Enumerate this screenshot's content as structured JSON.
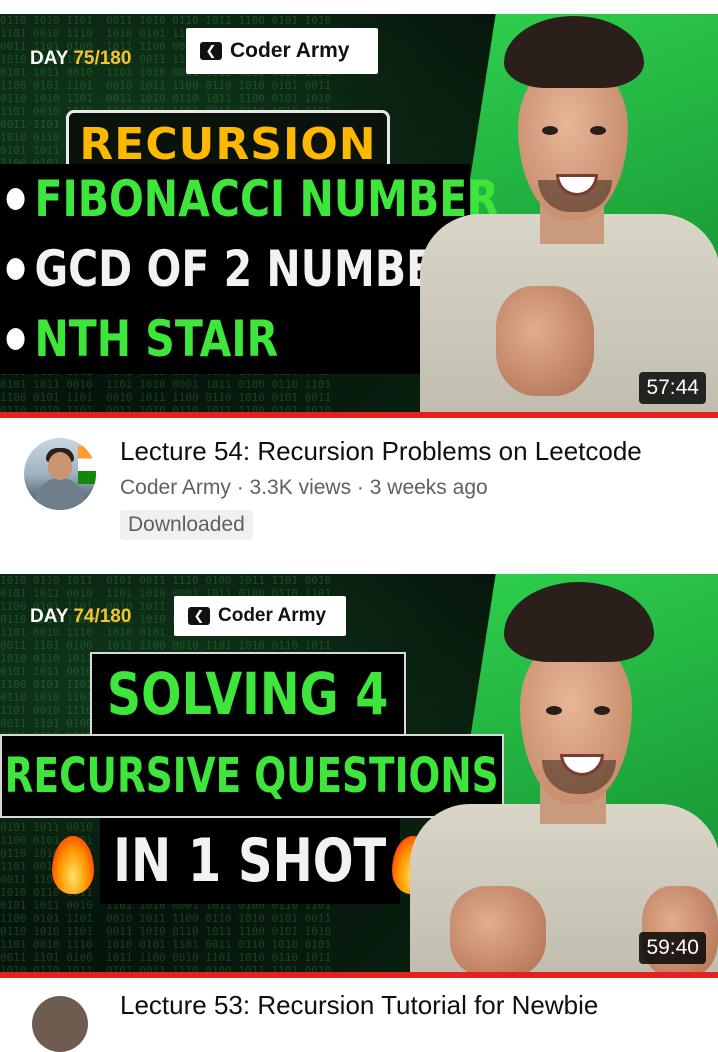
{
  "videos": [
    {
      "thumbnail": {
        "day_prefix": "DAY ",
        "day_value": "75/180",
        "brand": "Coder Army",
        "banner": "RECURSION",
        "bullets": [
          "FIBONACCI NUMBER",
          "GCD OF 2 NUMBER",
          "NTH STAIR"
        ]
      },
      "duration": "57:44",
      "title": "Lecture 54: Recursion Problems on Leetcode",
      "channel": "Coder Army",
      "separator": " · ",
      "views": "3.3K views",
      "age": "3 weeks ago",
      "badge": "Downloaded"
    },
    {
      "thumbnail": {
        "day_prefix": "DAY ",
        "day_value": "74/180",
        "brand": "Coder Army",
        "headline_1": "SOLVING 4",
        "headline_2": "RECURSIVE QUESTIONS",
        "headline_3": "IN 1 SHOT"
      },
      "duration": "59:40",
      "title_partial": "Lecture 53: Recursion Tutorial for Newbie"
    }
  ],
  "colors": {
    "progress_red": "#e52020",
    "title_green": "#3ee63b",
    "banner_yellow": "#ffb800",
    "panel_green": "#2fd14e"
  },
  "icons": [
    "coder-army-logo-icon",
    "fire-icon"
  ]
}
